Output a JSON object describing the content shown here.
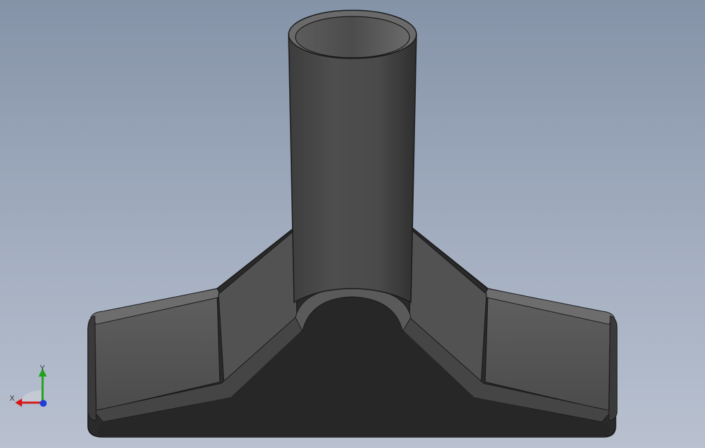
{
  "viewport": {
    "background_top": "#8593a8",
    "background_bottom": "#b9c1d0"
  },
  "model": {
    "part": "vacuum-nozzle-attachment",
    "colors": {
      "tube_light": "#5a5a5a",
      "tube_dark": "#3a3a3a",
      "face_mid": "#555555",
      "face_dark": "#2b2b2b",
      "edge": "#1a1a1a"
    }
  },
  "triad": {
    "x_label": "X",
    "y_label": "Y",
    "x_color": "#d41818",
    "y_color": "#1fa31f",
    "z_color": "#1f3fd4"
  }
}
